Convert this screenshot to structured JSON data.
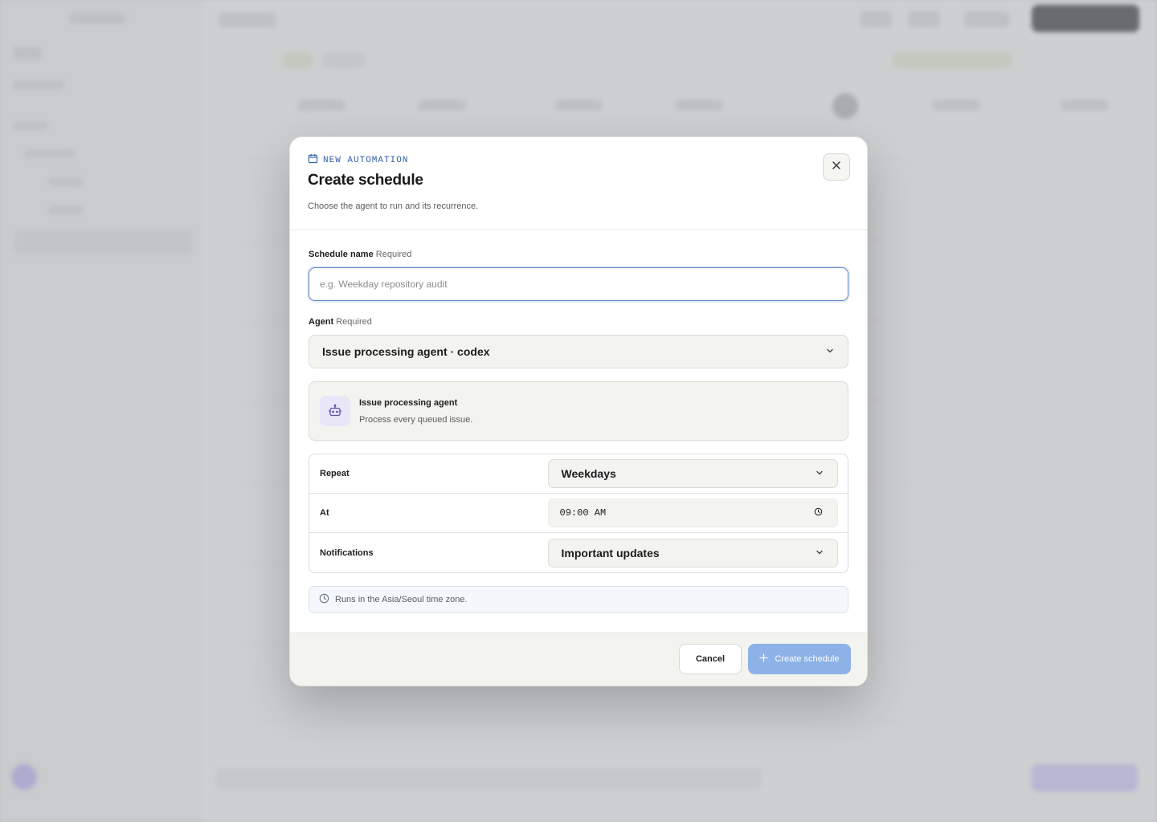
{
  "dialog": {
    "eyebrow": "NEW AUTOMATION",
    "title": "Create schedule",
    "subtitle": "Choose the agent to run and its recurrence."
  },
  "form": {
    "name_label": "Schedule name",
    "required": "Required",
    "name_placeholder": "e.g. Weekday repository audit",
    "name_value": "",
    "agent_label": "Agent",
    "agent_selected": "Issue processing agent · codex"
  },
  "agent_card": {
    "name": "Issue processing agent",
    "description": "Process every queued issue."
  },
  "settings": {
    "repeat_label": "Repeat",
    "repeat_value": "Weekdays",
    "at_label": "At",
    "at_value": "09:00 AM",
    "notifications_label": "Notifications",
    "notifications_value": "Important updates"
  },
  "timezone_note": "Runs in the Asia/Seoul time zone.",
  "footer": {
    "cancel": "Cancel",
    "create": "Create schedule"
  },
  "icons": {
    "eyebrow": "calendar-icon",
    "close": "close-icon",
    "agent": "robot-icon",
    "time": "clock-icon",
    "timezone": "clock-icon",
    "create": "plus-icon",
    "dropdown": "chevron-down-icon"
  },
  "colors": {
    "accent": "#2f5fa8",
    "primary_button_disabled": "#8db2e7",
    "agent_icon_bg": "#e9e6f8",
    "focus_border": "#5b84c7"
  }
}
